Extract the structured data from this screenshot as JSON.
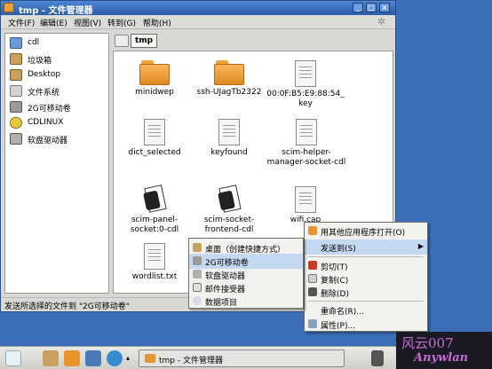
{
  "window": {
    "title": "tmp - 文件管理器"
  },
  "menubar": [
    "文件(F)",
    "编辑(E)",
    "视图(V)",
    "转到(G)",
    "帮助(H)"
  ],
  "sidebar": {
    "items": [
      {
        "label": "cdl",
        "icon": "computer-icon"
      },
      {
        "label": "垃圾箱",
        "icon": "trash-icon"
      },
      {
        "label": "Desktop",
        "icon": "desktop-icon"
      },
      {
        "label": "文件系统",
        "icon": "drive-icon"
      },
      {
        "label": "2G可移动卷",
        "icon": "usb-drive-icon"
      },
      {
        "label": "CDLINUX",
        "icon": "cdrom-icon"
      },
      {
        "label": "软盘驱动器",
        "icon": "floppy-icon"
      }
    ]
  },
  "breadcrumb": {
    "current": "tmp"
  },
  "files": [
    {
      "name": "minidwep",
      "type": "folder"
    },
    {
      "name": "ssh-UJagTb2322",
      "type": "folder"
    },
    {
      "name": "00:0F:B5:E9:88:54_key",
      "type": "doc"
    },
    {
      "name": "dict_selected",
      "type": "doc"
    },
    {
      "name": "keyfound",
      "type": "doc"
    },
    {
      "name": "scim-helper-manager-socket-cdl",
      "type": "doc"
    },
    {
      "name": "scim-panel-socket:0-cdl",
      "type": "socket"
    },
    {
      "name": "scim-socket-frontend-cdl",
      "type": "socket"
    },
    {
      "name": "wifi.cap",
      "type": "doc"
    },
    {
      "name": "wordlist.txt",
      "type": "doc"
    }
  ],
  "statusbar": {
    "text": "发送所选择的文件到 \"2G可移动卷\""
  },
  "context_menu": {
    "items": [
      {
        "label": "用其他应用程序打开(O)",
        "icon": "open-with-icon"
      },
      {
        "label": "发送到(S)",
        "icon": "",
        "submenu": true
      },
      {
        "label": "剪切(T)",
        "icon": "cut-icon"
      },
      {
        "label": "复制(C)",
        "icon": "copy-icon"
      },
      {
        "label": "删除(D)",
        "icon": "delete-icon"
      },
      {
        "label": "重命名(R)...",
        "icon": ""
      },
      {
        "label": "属性(P)...",
        "icon": "properties-icon"
      }
    ]
  },
  "submenu": {
    "items": [
      {
        "label": "桌面（创建快捷方式）",
        "icon": "desktop-icon"
      },
      {
        "label": "2G可移动卷",
        "icon": "usb-drive-icon"
      },
      {
        "label": "软盘驱动器",
        "icon": "floppy-icon"
      },
      {
        "label": "邮件接受器",
        "icon": "mail-icon"
      },
      {
        "label": "数据项目",
        "icon": "cd-icon"
      }
    ]
  },
  "taskbar": {
    "task_title": "tmp - 文件管理器"
  },
  "watermark": {
    "line1": "风云007",
    "line2": "Anywlan"
  },
  "colors": {
    "titlebar": "#2b5ca8",
    "highlight": "#c4d8f2",
    "folder": "#f0a23c"
  }
}
